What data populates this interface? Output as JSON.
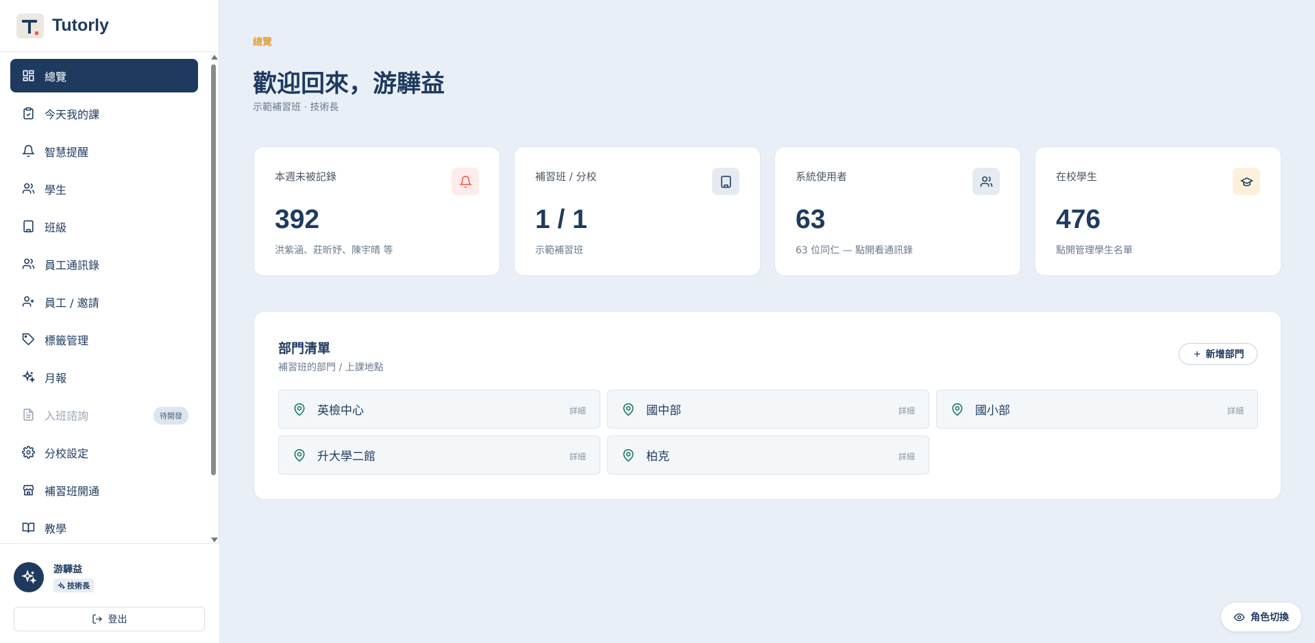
{
  "app": {
    "name": "Tutorly"
  },
  "colors": {
    "primary": "#1e3a5f",
    "accent": "#e8a23a",
    "background": "#e9eff6"
  },
  "sidebar": {
    "items": [
      {
        "label": "總覽",
        "icon": "dashboard-icon",
        "active": true
      },
      {
        "label": "今天我的課",
        "icon": "clipboard-check-icon"
      },
      {
        "label": "智慧提醒",
        "icon": "bell-icon"
      },
      {
        "label": "學生",
        "icon": "users-icon"
      },
      {
        "label": "班級",
        "icon": "building-icon"
      },
      {
        "label": "員工通訊錄",
        "icon": "users-icon"
      },
      {
        "label": "員工 / 邀請",
        "icon": "user-plus-icon"
      },
      {
        "label": "標籤管理",
        "icon": "tag-icon"
      },
      {
        "label": "月報",
        "icon": "sparkles-icon"
      },
      {
        "label": "入班諮詢",
        "icon": "file-text-icon",
        "disabled": true,
        "badge": "待開發"
      },
      {
        "label": "分校設定",
        "icon": "gear-icon"
      },
      {
        "label": "補習班開通",
        "icon": "store-icon"
      },
      {
        "label": "教學",
        "icon": "book-icon"
      }
    ],
    "user": {
      "name": "游驊益",
      "role": "技術長"
    },
    "logout_label": "登出"
  },
  "main": {
    "breadcrumb": "總覽",
    "title": "歡迎回來，游驊益",
    "subtitle": "示範補習班 · 技術長",
    "stats": [
      {
        "label": "本週未被記錄",
        "value": "392",
        "desc": "洪紫涵、莊昕妤、陳宇晴 等",
        "icon": "bell-icon"
      },
      {
        "label": "補習班 / 分校",
        "value": "1 / 1",
        "desc": "示範補習班",
        "icon": "building-icon"
      },
      {
        "label": "系統使用者",
        "value": "63",
        "desc": "63 位同仁 — 點開看通訊錄",
        "icon": "users-icon"
      },
      {
        "label": "在校學生",
        "value": "476",
        "desc": "點開管理學生名單",
        "icon": "graduation-cap-icon"
      }
    ],
    "departments": {
      "title": "部門清單",
      "subtitle": "補習班的部門 / 上課地點",
      "add_label": "新增部門",
      "detail_label": "詳細",
      "items": [
        {
          "name": "英檢中心"
        },
        {
          "name": "國中部"
        },
        {
          "name": "國小部"
        },
        {
          "name": "升大學二館"
        },
        {
          "name": "柏克"
        }
      ]
    },
    "role_switch_label": "角色切換"
  }
}
